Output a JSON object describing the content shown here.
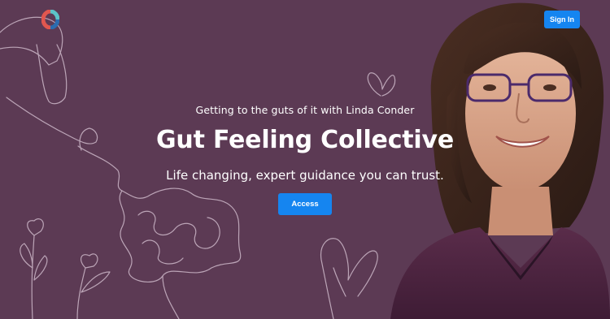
{
  "header": {
    "logo_icon": "brand-logo-icon",
    "signin_label": "Sign In"
  },
  "hero": {
    "tagline": "Getting to the guts of it with Linda Conder",
    "title": "Gut Feeling Collective",
    "subtitle": "Life changing, expert guidance you can trust.",
    "cta_label": "Access"
  },
  "colors": {
    "background": "#5c3a54",
    "accent": "#1585f0",
    "text": "#ffffff",
    "lineart": "#d9c7d6"
  }
}
